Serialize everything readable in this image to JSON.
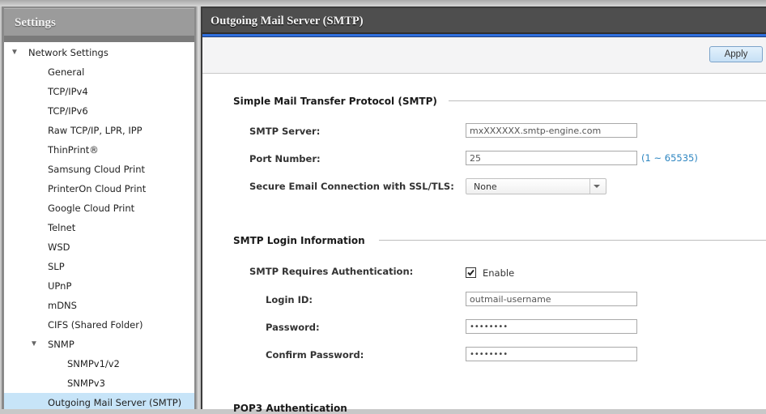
{
  "sidebar": {
    "title": "Settings",
    "items": [
      {
        "label": "Network Settings",
        "level": 0,
        "expanded": true
      },
      {
        "label": "General",
        "level": 1
      },
      {
        "label": "TCP/IPv4",
        "level": 1
      },
      {
        "label": "TCP/IPv6",
        "level": 1
      },
      {
        "label": "Raw TCP/IP, LPR, IPP",
        "level": 1
      },
      {
        "label": "ThinPrint®",
        "level": 1
      },
      {
        "label": "Samsung Cloud Print",
        "level": 1
      },
      {
        "label": "PrinterOn Cloud Print",
        "level": 1
      },
      {
        "label": "Google Cloud Print",
        "level": 1
      },
      {
        "label": "Telnet",
        "level": 1
      },
      {
        "label": "WSD",
        "level": 1
      },
      {
        "label": "SLP",
        "level": 1
      },
      {
        "label": "UPnP",
        "level": 1
      },
      {
        "label": "mDNS",
        "level": 1
      },
      {
        "label": "CIFS (Shared Folder)",
        "level": 1
      },
      {
        "label": "SNMP",
        "level": 1,
        "expanded": true
      },
      {
        "label": "SNMPv1/v2",
        "level": 2
      },
      {
        "label": "SNMPv3",
        "level": 2
      },
      {
        "label": "Outgoing Mail Server (SMTP)",
        "level": 1,
        "selected": true
      }
    ],
    "caret_glyph": "▼"
  },
  "main": {
    "title": "Outgoing Mail Server (SMTP)",
    "toolbar": {
      "apply_label": "Apply"
    },
    "smtp_section": {
      "title": "Simple Mail Transfer Protocol (SMTP)",
      "server_label": "SMTP Server:",
      "server_value": "mxXXXXXX.smtp-engine.com",
      "port_label": "Port Number:",
      "port_value": "25",
      "port_hint": "(1 ~ 65535)",
      "ssl_label": "Secure Email Connection with SSL/TLS:",
      "ssl_value": "None"
    },
    "login_section": {
      "title": "SMTP Login Information",
      "auth_label": "SMTP Requires Authentication:",
      "auth_checked": true,
      "auth_option": "Enable",
      "login_label": "Login ID:",
      "login_value": "outmail-username",
      "password_label": "Password:",
      "password_value": "••••••••",
      "confirm_label": "Confirm Password:",
      "confirm_value": "••••••••"
    },
    "pop3_section": {
      "title": "POP3 Authentication"
    }
  },
  "colors": {
    "accent_blue": "#2f6fde",
    "selected_item": "#c7e4f8",
    "hint_text": "#2e86c1"
  }
}
